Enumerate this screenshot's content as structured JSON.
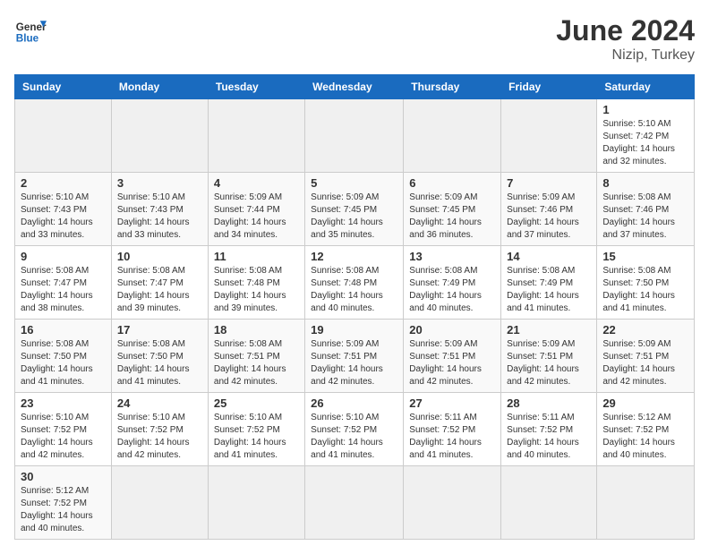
{
  "header": {
    "logo_general": "General",
    "logo_blue": "Blue",
    "month": "June 2024",
    "location": "Nizip, Turkey"
  },
  "weekdays": [
    "Sunday",
    "Monday",
    "Tuesday",
    "Wednesday",
    "Thursday",
    "Friday",
    "Saturday"
  ],
  "weeks": [
    [
      {
        "day": "",
        "info": ""
      },
      {
        "day": "",
        "info": ""
      },
      {
        "day": "",
        "info": ""
      },
      {
        "day": "",
        "info": ""
      },
      {
        "day": "",
        "info": ""
      },
      {
        "day": "",
        "info": ""
      },
      {
        "day": "1",
        "info": "Sunrise: 5:10 AM\nSunset: 7:42 PM\nDaylight: 14 hours\nand 32 minutes."
      }
    ],
    [
      {
        "day": "2",
        "info": "Sunrise: 5:10 AM\nSunset: 7:43 PM\nDaylight: 14 hours\nand 33 minutes."
      },
      {
        "day": "3",
        "info": "Sunrise: 5:10 AM\nSunset: 7:43 PM\nDaylight: 14 hours\nand 33 minutes."
      },
      {
        "day": "4",
        "info": "Sunrise: 5:09 AM\nSunset: 7:44 PM\nDaylight: 14 hours\nand 34 minutes."
      },
      {
        "day": "5",
        "info": "Sunrise: 5:09 AM\nSunset: 7:45 PM\nDaylight: 14 hours\nand 35 minutes."
      },
      {
        "day": "6",
        "info": "Sunrise: 5:09 AM\nSunset: 7:45 PM\nDaylight: 14 hours\nand 36 minutes."
      },
      {
        "day": "7",
        "info": "Sunrise: 5:09 AM\nSunset: 7:46 PM\nDaylight: 14 hours\nand 37 minutes."
      },
      {
        "day": "8",
        "info": "Sunrise: 5:08 AM\nSunset: 7:46 PM\nDaylight: 14 hours\nand 37 minutes."
      }
    ],
    [
      {
        "day": "9",
        "info": "Sunrise: 5:08 AM\nSunset: 7:47 PM\nDaylight: 14 hours\nand 38 minutes."
      },
      {
        "day": "10",
        "info": "Sunrise: 5:08 AM\nSunset: 7:47 PM\nDaylight: 14 hours\nand 39 minutes."
      },
      {
        "day": "11",
        "info": "Sunrise: 5:08 AM\nSunset: 7:48 PM\nDaylight: 14 hours\nand 39 minutes."
      },
      {
        "day": "12",
        "info": "Sunrise: 5:08 AM\nSunset: 7:48 PM\nDaylight: 14 hours\nand 40 minutes."
      },
      {
        "day": "13",
        "info": "Sunrise: 5:08 AM\nSunset: 7:49 PM\nDaylight: 14 hours\nand 40 minutes."
      },
      {
        "day": "14",
        "info": "Sunrise: 5:08 AM\nSunset: 7:49 PM\nDaylight: 14 hours\nand 41 minutes."
      },
      {
        "day": "15",
        "info": "Sunrise: 5:08 AM\nSunset: 7:50 PM\nDaylight: 14 hours\nand 41 minutes."
      }
    ],
    [
      {
        "day": "16",
        "info": "Sunrise: 5:08 AM\nSunset: 7:50 PM\nDaylight: 14 hours\nand 41 minutes."
      },
      {
        "day": "17",
        "info": "Sunrise: 5:08 AM\nSunset: 7:50 PM\nDaylight: 14 hours\nand 41 minutes."
      },
      {
        "day": "18",
        "info": "Sunrise: 5:08 AM\nSunset: 7:51 PM\nDaylight: 14 hours\nand 42 minutes."
      },
      {
        "day": "19",
        "info": "Sunrise: 5:09 AM\nSunset: 7:51 PM\nDaylight: 14 hours\nand 42 minutes."
      },
      {
        "day": "20",
        "info": "Sunrise: 5:09 AM\nSunset: 7:51 PM\nDaylight: 14 hours\nand 42 minutes."
      },
      {
        "day": "21",
        "info": "Sunrise: 5:09 AM\nSunset: 7:51 PM\nDaylight: 14 hours\nand 42 minutes."
      },
      {
        "day": "22",
        "info": "Sunrise: 5:09 AM\nSunset: 7:51 PM\nDaylight: 14 hours\nand 42 minutes."
      }
    ],
    [
      {
        "day": "23",
        "info": "Sunrise: 5:10 AM\nSunset: 7:52 PM\nDaylight: 14 hours\nand 42 minutes."
      },
      {
        "day": "24",
        "info": "Sunrise: 5:10 AM\nSunset: 7:52 PM\nDaylight: 14 hours\nand 42 minutes."
      },
      {
        "day": "25",
        "info": "Sunrise: 5:10 AM\nSunset: 7:52 PM\nDaylight: 14 hours\nand 41 minutes."
      },
      {
        "day": "26",
        "info": "Sunrise: 5:10 AM\nSunset: 7:52 PM\nDaylight: 14 hours\nand 41 minutes."
      },
      {
        "day": "27",
        "info": "Sunrise: 5:11 AM\nSunset: 7:52 PM\nDaylight: 14 hours\nand 41 minutes."
      },
      {
        "day": "28",
        "info": "Sunrise: 5:11 AM\nSunset: 7:52 PM\nDaylight: 14 hours\nand 40 minutes."
      },
      {
        "day": "29",
        "info": "Sunrise: 5:12 AM\nSunset: 7:52 PM\nDaylight: 14 hours\nand 40 minutes."
      }
    ],
    [
      {
        "day": "30",
        "info": "Sunrise: 5:12 AM\nSunset: 7:52 PM\nDaylight: 14 hours\nand 40 minutes."
      },
      {
        "day": "",
        "info": ""
      },
      {
        "day": "",
        "info": ""
      },
      {
        "day": "",
        "info": ""
      },
      {
        "day": "",
        "info": ""
      },
      {
        "day": "",
        "info": ""
      },
      {
        "day": "",
        "info": ""
      }
    ]
  ]
}
